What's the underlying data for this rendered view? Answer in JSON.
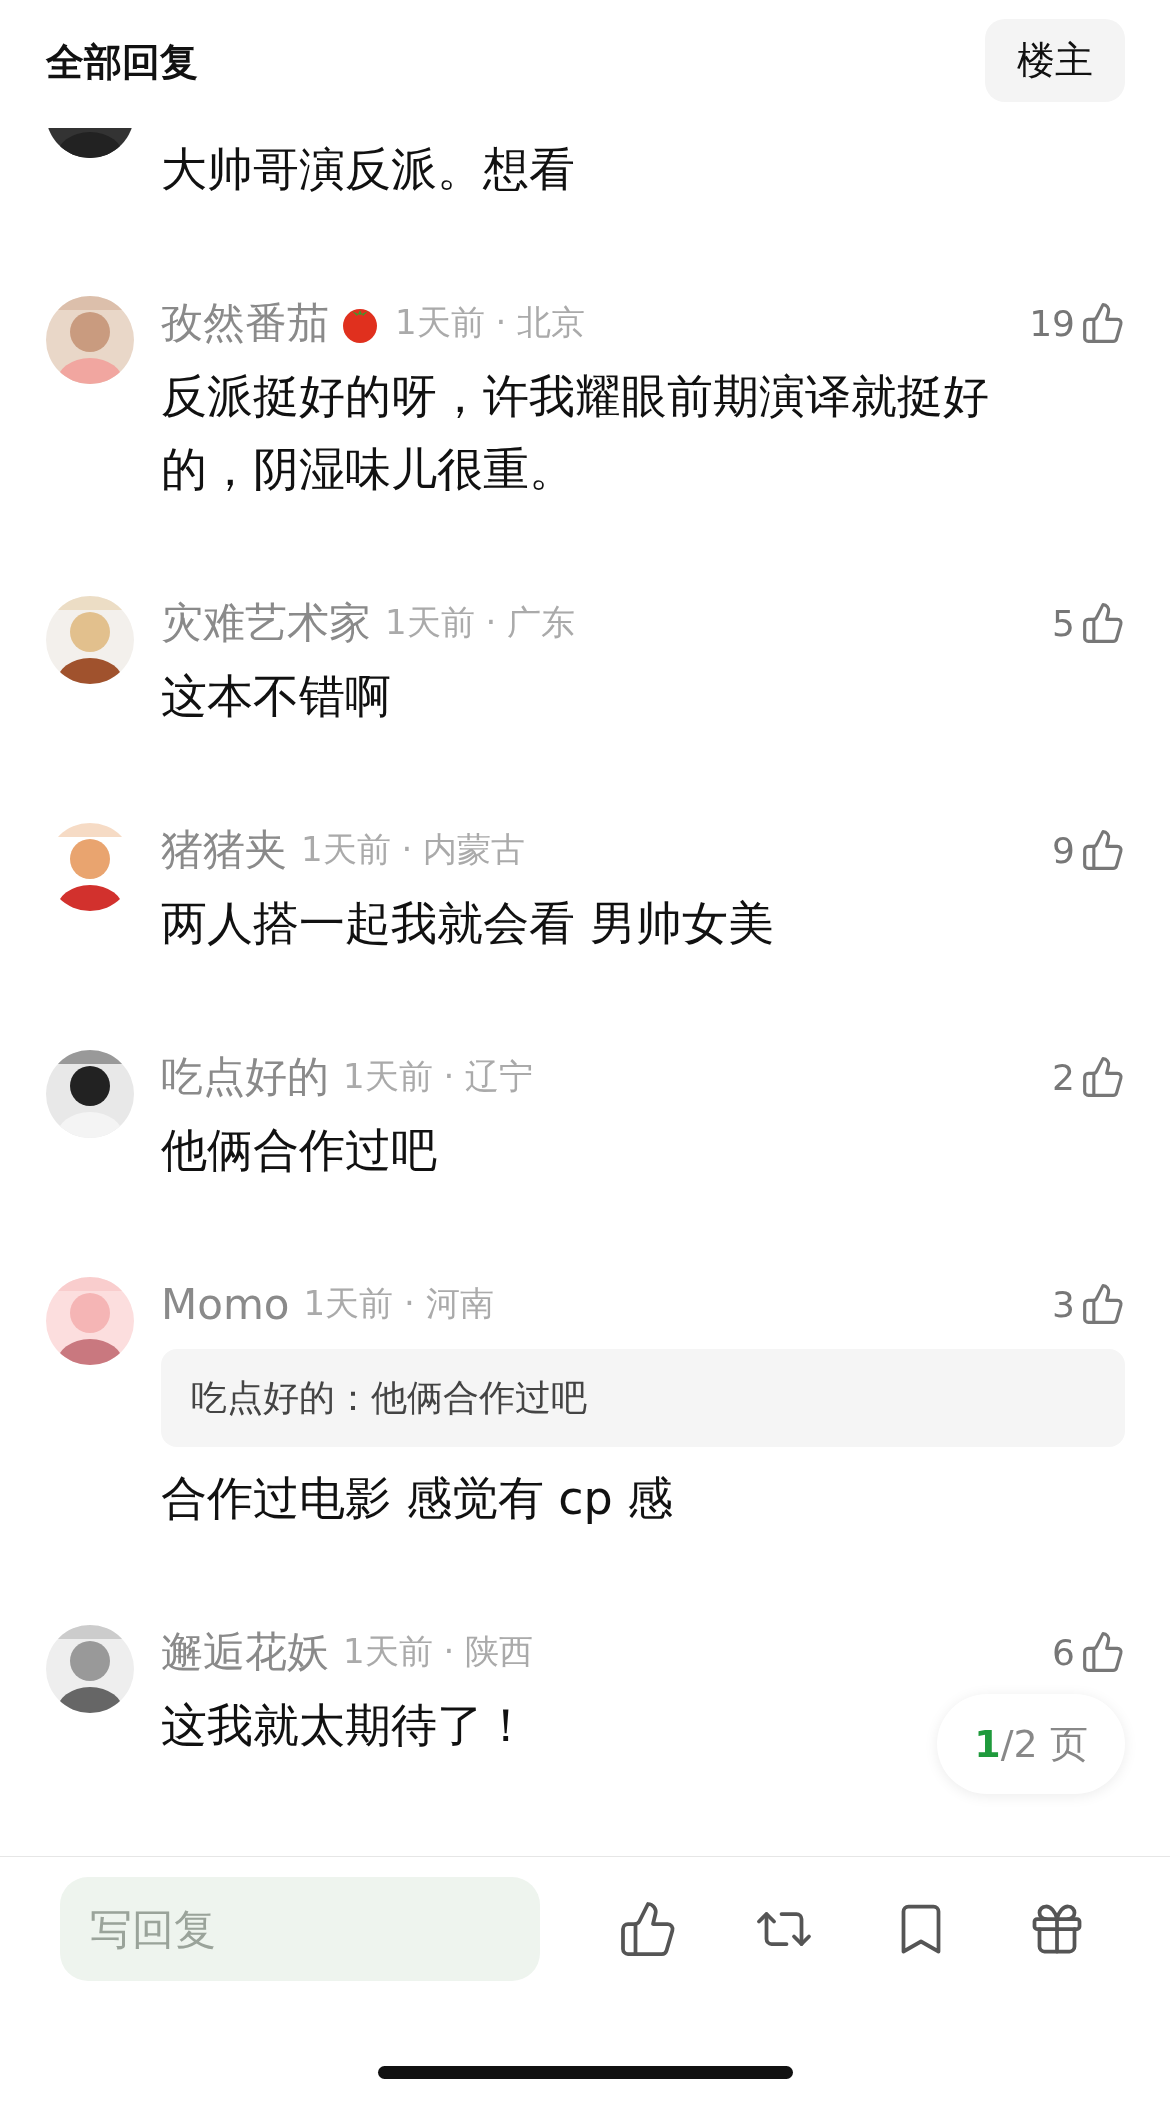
{
  "header": {
    "title": "全部回复",
    "filter_button": "楼主"
  },
  "comments": [
    {
      "kind": "partial",
      "text": "大帅哥演反派。想看"
    },
    {
      "kind": "comment",
      "author": "孜然番茄",
      "emoji_badge": true,
      "meta": "1天前 · 北京",
      "likes": "19",
      "text": "反派挺好的呀，许我耀眼前期演译就挺好的，阴湿味儿很重。"
    },
    {
      "kind": "comment",
      "author": "灾难艺术家",
      "emoji_badge": false,
      "meta": "1天前 · 广东",
      "likes": "5",
      "text": "这本不错啊"
    },
    {
      "kind": "comment",
      "author": "猪猪夹",
      "emoji_badge": false,
      "meta": "1天前 · 内蒙古",
      "likes": "9",
      "text": "两人搭一起我就会看 男帅女美"
    },
    {
      "kind": "comment",
      "author": "吃点好的",
      "emoji_badge": false,
      "meta": "1天前 · 辽宁",
      "likes": "2",
      "text": "他俩合作过吧"
    },
    {
      "kind": "comment",
      "author": "Momo",
      "emoji_badge": false,
      "meta": "1天前 · 河南",
      "likes": "3",
      "quote": "吃点好的：他俩合作过吧",
      "text": "合作过电影 感觉有 cp 感"
    },
    {
      "kind": "comment",
      "author": "邂逅花妖",
      "emoji_badge": false,
      "meta": "1天前 · 陕西",
      "likes": "6",
      "text": "这我就太期待了！"
    }
  ],
  "pager": {
    "current": "1",
    "rest": "/2 页"
  },
  "reply_bar": {
    "placeholder": "写回复"
  }
}
